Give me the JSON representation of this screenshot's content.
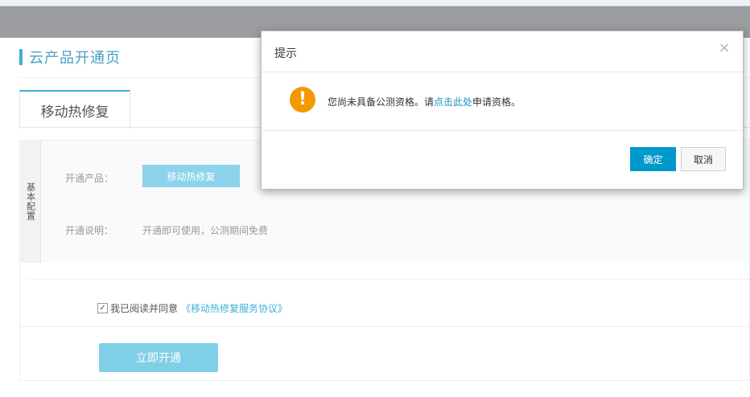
{
  "page": {
    "title": "云产品开通页",
    "tab_label": "移动热修复",
    "section_label": "基本配置",
    "product_label": "开通产品：",
    "product_value": "移动热修复",
    "desc_label": "开通说明：",
    "desc_value": "开通即可使用，公测期间免费",
    "agree_checkbox": "✓",
    "agree_text": "我已阅读并同意",
    "agree_link": "《移动热修复服务协议》",
    "open_button": "立即开通"
  },
  "dialog": {
    "title": "提示",
    "close_icon": "×",
    "warning_icon": "!",
    "message_prefix": "您尚未具备公测资格。请",
    "message_link": "点击此处",
    "message_suffix": "申请资格。",
    "ok_button": "确定",
    "cancel_button": "取消"
  },
  "colors": {
    "accent": "#3fb0d5",
    "primary_button": "#0099cc",
    "warning": "#f39800"
  }
}
